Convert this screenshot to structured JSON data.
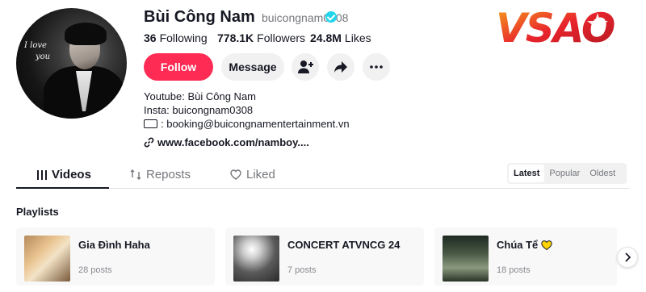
{
  "profile": {
    "name": "Bùi Công Nam",
    "handle": "buicongnam0308",
    "avatar_text_line1": "I love",
    "avatar_text_line2": "you"
  },
  "stats": [
    {
      "value": "36",
      "label": "Following"
    },
    {
      "value": "778.1K",
      "label": "Followers"
    },
    {
      "value": "24.8M",
      "label": "Likes"
    }
  ],
  "actions": {
    "follow_label": "Follow",
    "message_label": "Message",
    "add_friend_icon": "add-user-icon",
    "share_icon": "share-icon",
    "more_icon": "more-icon"
  },
  "bio": {
    "line1": "Youtube: Bùi Công Nam",
    "line2": "Insta: buicongnam0308",
    "line3": ": booking@buicongnamentertainment.vn",
    "link": "www.facebook.com/namboy...."
  },
  "logo": {
    "text": "VSAO",
    "colors": {
      "primary": "#e8242c",
      "accent": "#f7a51c"
    }
  },
  "tabs": [
    {
      "label": "Videos",
      "active": true
    },
    {
      "label": "Reposts",
      "active": false
    },
    {
      "label": "Liked",
      "active": false
    }
  ],
  "sort": [
    {
      "label": "Latest",
      "active": true
    },
    {
      "label": "Popular",
      "active": false
    },
    {
      "label": "Oldest",
      "active": false
    }
  ],
  "playlists": {
    "heading": "Playlists",
    "items": [
      {
        "title": "Gia Đình Haha",
        "count": "28 posts"
      },
      {
        "title": "CONCERT ATVNCG 24",
        "count": "7 posts"
      },
      {
        "title": "Chúa Tể",
        "count": "18 posts",
        "emoji": "yellow-heart-icon"
      }
    ]
  },
  "colors": {
    "follow_button": "#fe2c55",
    "verified": "#20d5ec",
    "text_primary": "#161823",
    "text_secondary": "#75777c"
  }
}
